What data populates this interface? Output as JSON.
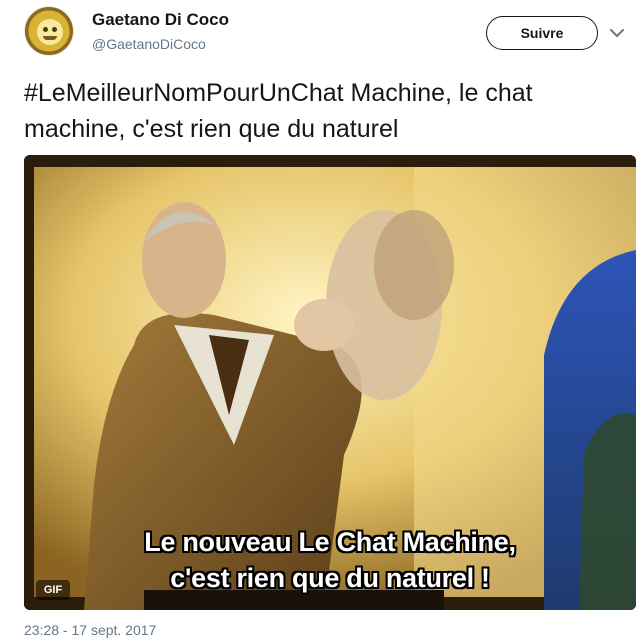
{
  "user": {
    "display_name": "Gaetano Di Coco",
    "handle": "@GaetanoDiCoco"
  },
  "actions": {
    "follow_label": "Suivre",
    "menu_icon": "chevron-down-icon"
  },
  "tweet": {
    "text": "#LeMeilleurNomPourUnChat Machine, le chat machine, c'est rien que du naturel",
    "timestamp": "23:28 - 17 sept. 2017"
  },
  "media": {
    "subtitle_line1": "Le nouveau Le Chat Machine,",
    "subtitle_line2": "c'est rien que du naturel !",
    "badge": "GIF"
  },
  "colors": {
    "text": "#14171a",
    "secondary": "#657786",
    "media_warm": "#c9a24a",
    "media_sky": "#2f4f9a"
  }
}
